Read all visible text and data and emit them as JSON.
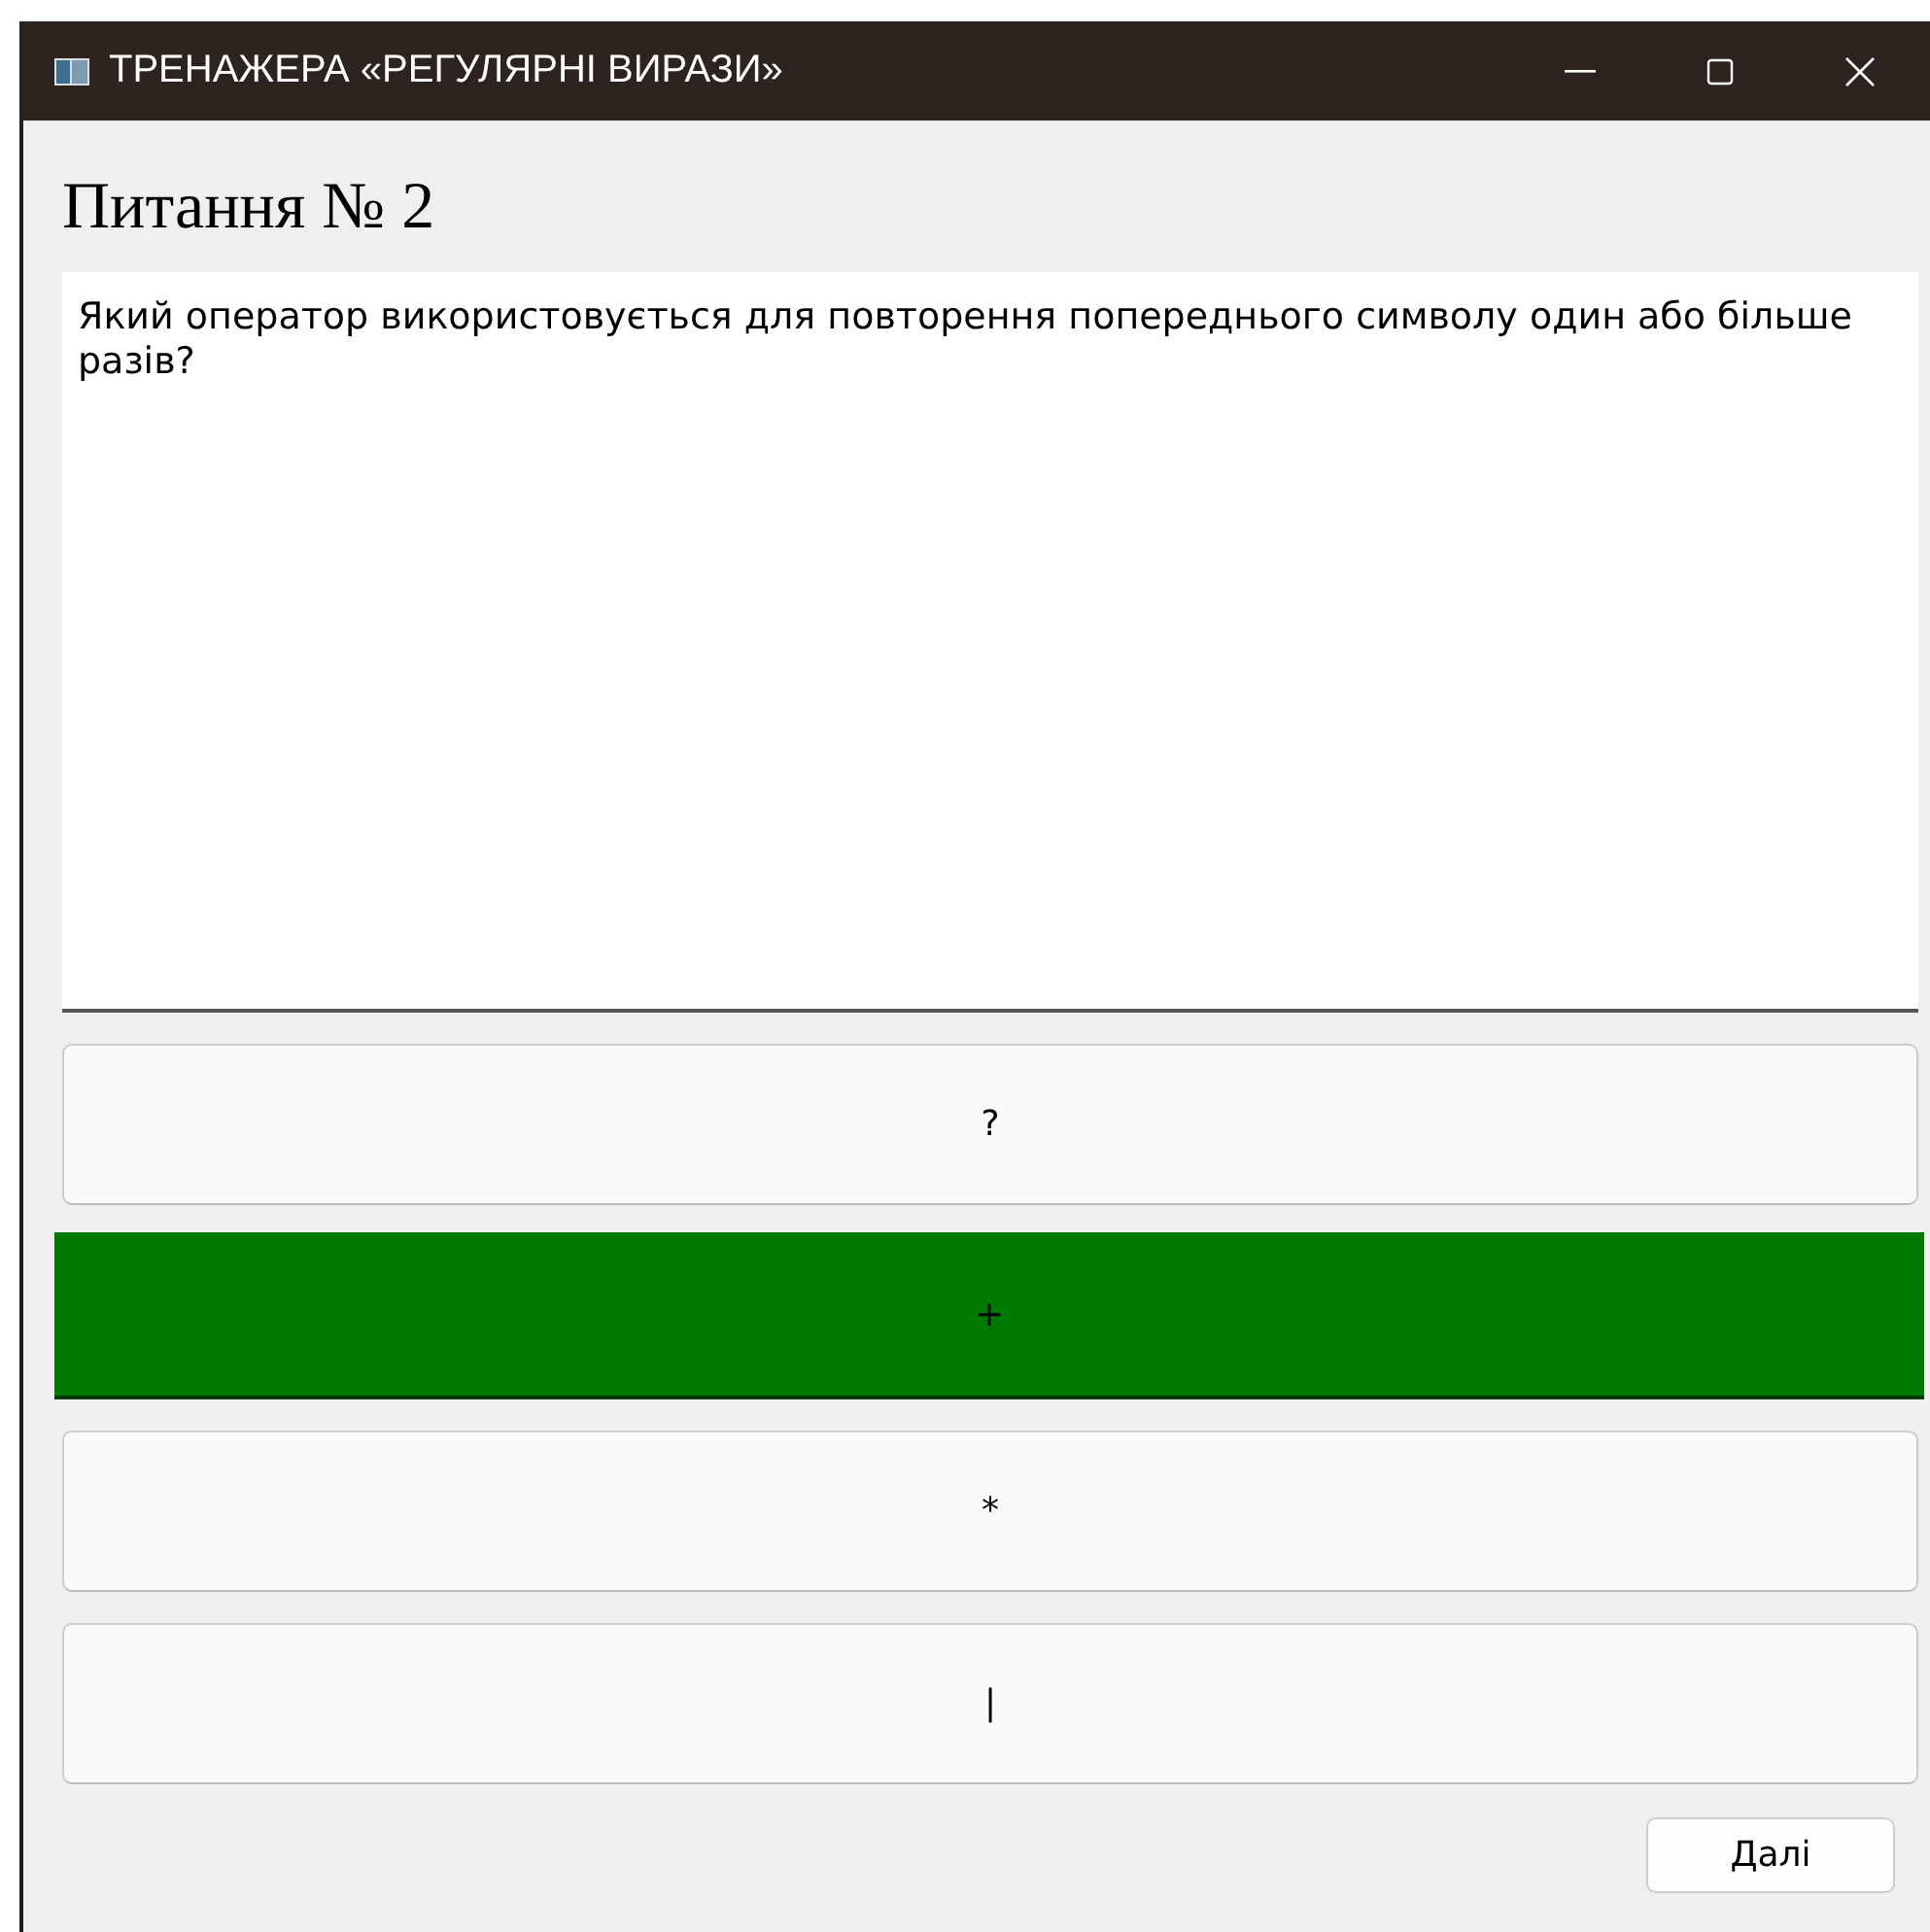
{
  "window": {
    "title": "ТРЕНАЖЕРА «РЕГУЛЯРНІ ВИРАЗИ»"
  },
  "heading": "Питання № 2",
  "question": "Який оператор використовується для повторення попереднього символу один або більше разів?",
  "answers": [
    {
      "label": "?",
      "correct": false
    },
    {
      "label": "+",
      "correct": true
    },
    {
      "label": "*",
      "correct": false
    },
    {
      "label": "|",
      "correct": false
    }
  ],
  "next_button": "Далі"
}
